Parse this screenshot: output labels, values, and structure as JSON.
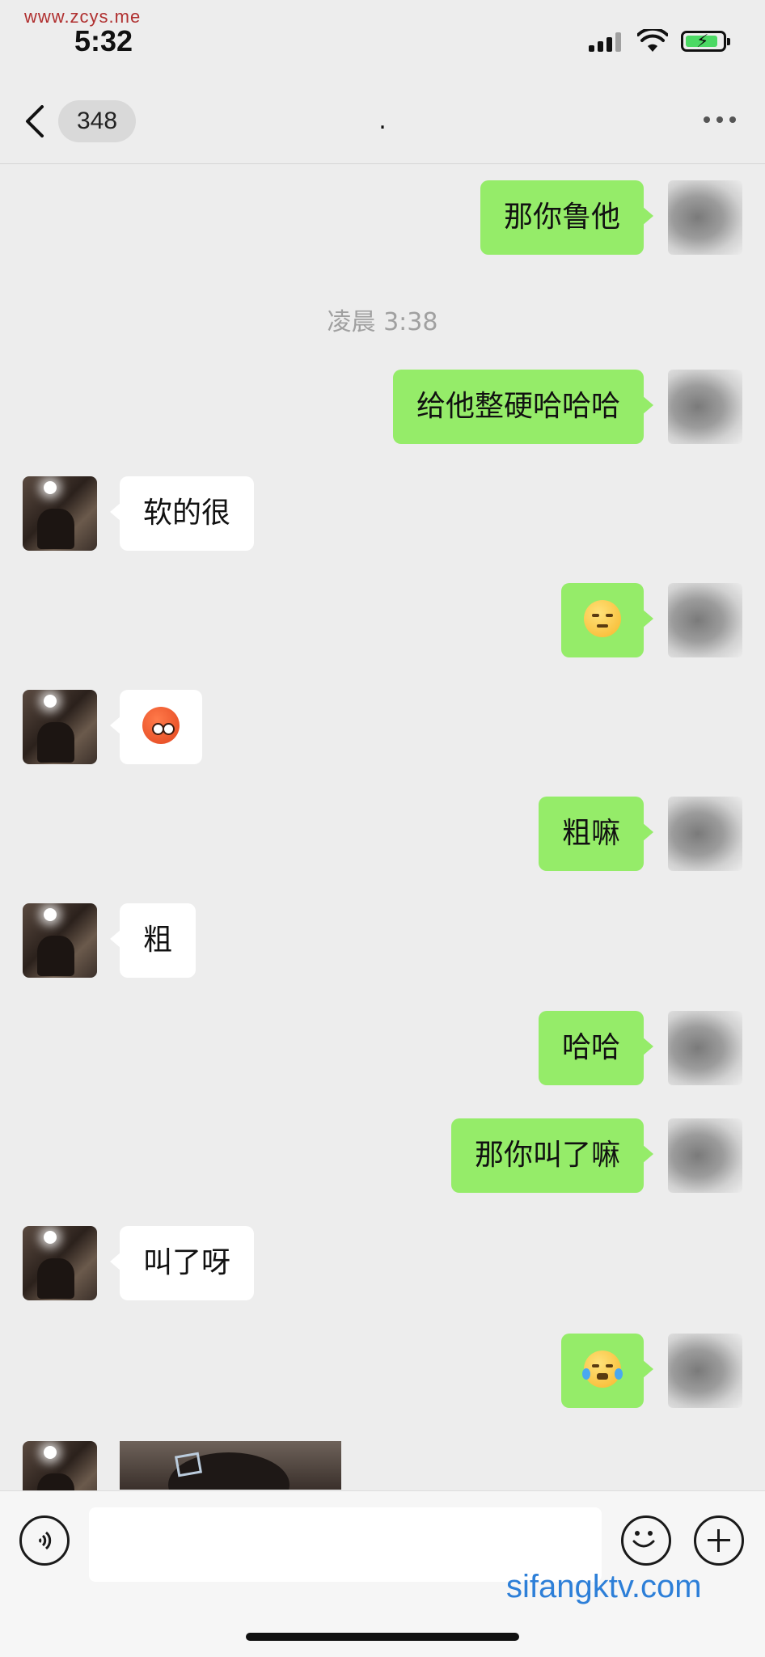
{
  "watermark_top": "www.zcys.me",
  "watermark_bottom": "sifangktv.com",
  "status_bar": {
    "time": "5:32",
    "battery_charging": true
  },
  "nav": {
    "unread_badge": "348",
    "title": ".",
    "back_icon": "chevron-left-icon",
    "more_icon": "ellipsis-icon"
  },
  "messages": [
    {
      "side": "me",
      "type": "text",
      "text": "那你鲁他"
    },
    {
      "type": "timestamp",
      "text": "凌晨 3:38"
    },
    {
      "side": "me",
      "type": "text",
      "text": "给他整硬哈哈哈"
    },
    {
      "side": "them",
      "type": "text",
      "text": "软的很"
    },
    {
      "side": "me",
      "type": "emoji",
      "emoji": "relieved-face"
    },
    {
      "side": "them",
      "type": "emoji",
      "emoji": "flushed-face"
    },
    {
      "side": "me",
      "type": "text",
      "text": "粗嘛"
    },
    {
      "side": "them",
      "type": "text",
      "text": "粗"
    },
    {
      "side": "me",
      "type": "text",
      "text": "哈哈"
    },
    {
      "side": "me",
      "type": "text",
      "text": "那你叫了嘛"
    },
    {
      "side": "them",
      "type": "text",
      "text": "叫了呀"
    },
    {
      "side": "me",
      "type": "emoji",
      "emoji": "rolling-laugh-face"
    },
    {
      "side": "them",
      "type": "image",
      "image": "photo-thumbnail"
    }
  ],
  "input_bar": {
    "voice_icon": "voice-icon",
    "emoji_icon": "smiley-icon",
    "plus_icon": "plus-icon",
    "text_value": ""
  },
  "colors": {
    "my_bubble": "#95ec69",
    "their_bubble": "#ffffff",
    "background": "#ededed",
    "watermark_bottom": "#2d7fd8"
  }
}
